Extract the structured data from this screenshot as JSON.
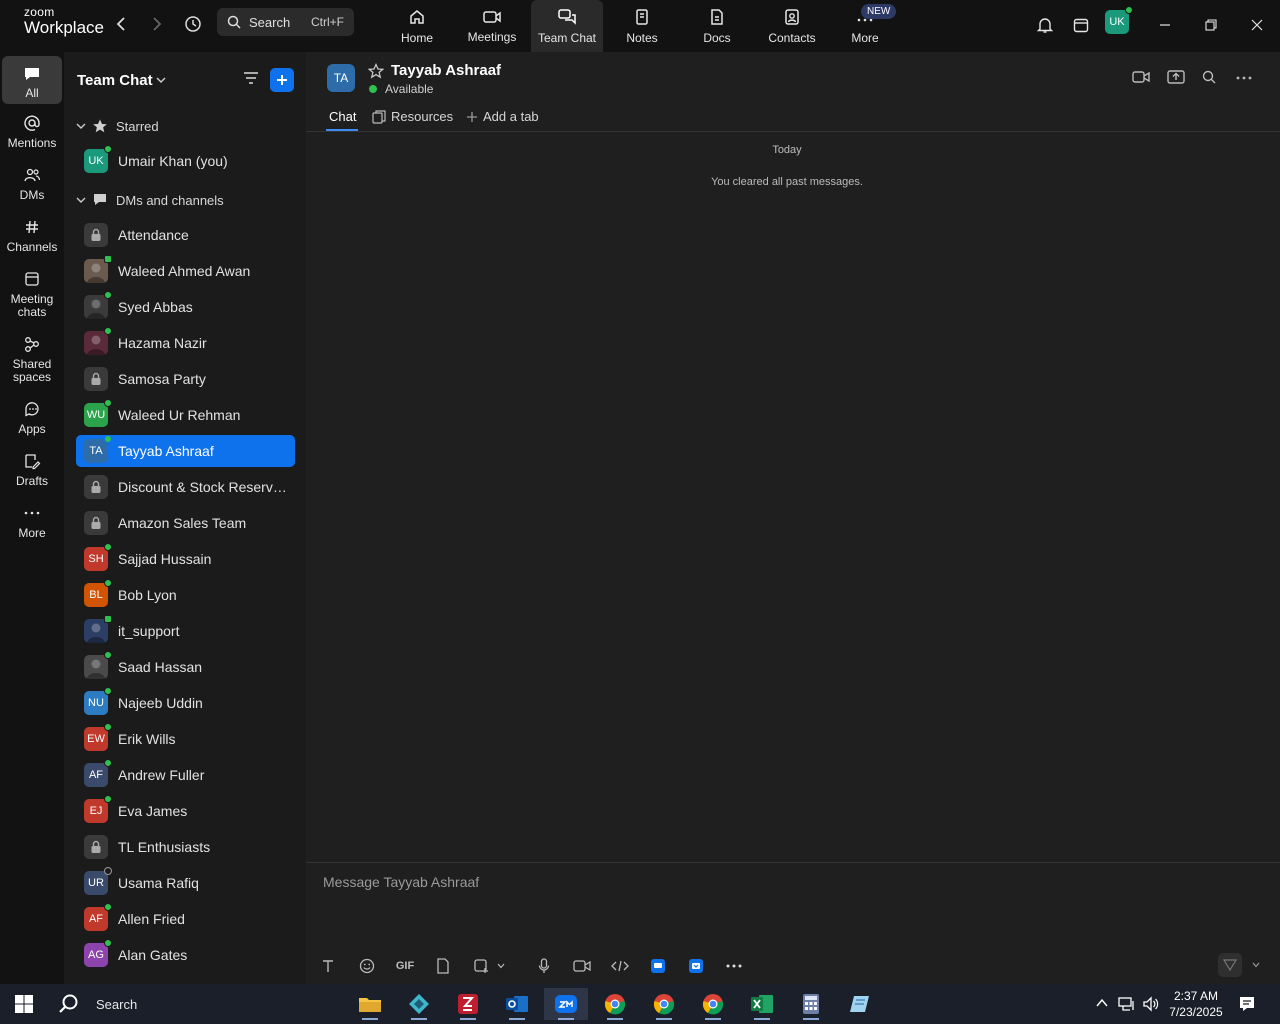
{
  "app": {
    "logo_line1": "zoom",
    "logo_line2": "Workplace",
    "search_label": "Search",
    "search_shortcut": "Ctrl+F",
    "new_badge": "NEW",
    "user_initials": "UK",
    "accent": "#0e72ed",
    "online_color": "#2fc14f"
  },
  "top_tabs": [
    {
      "label": "Home",
      "icon": "home-icon"
    },
    {
      "label": "Meetings",
      "icon": "video-camera-icon"
    },
    {
      "label": "Team Chat",
      "icon": "chat-bubbles-icon",
      "active": true
    },
    {
      "label": "Notes",
      "icon": "notes-icon"
    },
    {
      "label": "Docs",
      "icon": "docs-icon"
    },
    {
      "label": "Contacts",
      "icon": "contacts-icon"
    },
    {
      "label": "More",
      "icon": "more-dots-icon"
    }
  ],
  "rail": [
    {
      "label": "All",
      "active": true
    },
    {
      "label": "Mentions"
    },
    {
      "label": "DMs"
    },
    {
      "label": "Channels"
    },
    {
      "label": "Meeting chats"
    },
    {
      "label": "Shared spaces"
    },
    {
      "label": "Apps"
    },
    {
      "label": "Drafts"
    },
    {
      "label": "More"
    }
  ],
  "list": {
    "title": "Team Chat",
    "starred_label": "Starred",
    "dms_label": "DMs and channels",
    "starred": [
      {
        "name": "Umair Khan (you)",
        "initials": "UK",
        "color": "#1a9a7a",
        "status": "online"
      }
    ],
    "items": [
      {
        "name": "Attendance",
        "type": "channel"
      },
      {
        "name": "Waleed Ahmed Awan",
        "type": "photo",
        "color": "#6b5a4e",
        "status": "mobile"
      },
      {
        "name": "Syed Abbas",
        "type": "photo",
        "color": "#3b3b3b",
        "status": "online"
      },
      {
        "name": "Hazama Nazir",
        "type": "photo",
        "color": "#5a2a3a",
        "status": "online"
      },
      {
        "name": "Samosa Party",
        "type": "channel"
      },
      {
        "name": "Waleed Ur Rehman",
        "initials": "WU",
        "color": "#2aa34a",
        "status": "online"
      },
      {
        "name": "Tayyab Ashraaf",
        "initials": "TA",
        "color": "#2d6ca8",
        "status": "online",
        "selected": true
      },
      {
        "name": "Discount & Stock Reservati...",
        "type": "channel"
      },
      {
        "name": "Amazon Sales Team",
        "type": "channel"
      },
      {
        "name": "Sajjad Hussain",
        "initials": "SH",
        "color": "#c0392b",
        "status": "online"
      },
      {
        "name": "Bob Lyon",
        "initials": "BL",
        "color": "#d35400",
        "status": "online"
      },
      {
        "name": "it_support",
        "type": "photo",
        "color": "#2c3e66",
        "status": "mobile"
      },
      {
        "name": "Saad Hassan",
        "type": "photo",
        "color": "#4a4a4a",
        "status": "online"
      },
      {
        "name": "Najeeb Uddin",
        "initials": "NU",
        "color": "#2d7cc1",
        "status": "online"
      },
      {
        "name": "Erik Wills",
        "initials": "EW",
        "color": "#c0392b",
        "status": "online"
      },
      {
        "name": "Andrew Fuller",
        "initials": "AF",
        "color": "#3a4a6a",
        "status": "online"
      },
      {
        "name": "Eva James",
        "initials": "EJ",
        "color": "#c0392b",
        "status": "online"
      },
      {
        "name": "TL Enthusiasts",
        "type": "channel"
      },
      {
        "name": "Usama Rafiq",
        "initials": "UR",
        "color": "#3a4a6a",
        "status": "away"
      },
      {
        "name": "Allen Fried",
        "initials": "AF",
        "color": "#c0392b",
        "status": "online"
      },
      {
        "name": "Alan Gates",
        "initials": "AG",
        "color": "#8e44ad",
        "status": "online"
      }
    ]
  },
  "chat": {
    "initials": "TA",
    "name": "Tayyab Ashraaf",
    "status": "Available",
    "tabs": [
      "Chat",
      "Resources",
      "Add a tab"
    ],
    "date_divider": "Today",
    "system_message": "You cleared all past messages.",
    "composer_placeholder": "Message Tayyab Ashraaf",
    "gif_label": "GIF"
  },
  "taskbar": {
    "search_label": "Search",
    "time": "2:37 AM",
    "date": "7/23/2025"
  }
}
